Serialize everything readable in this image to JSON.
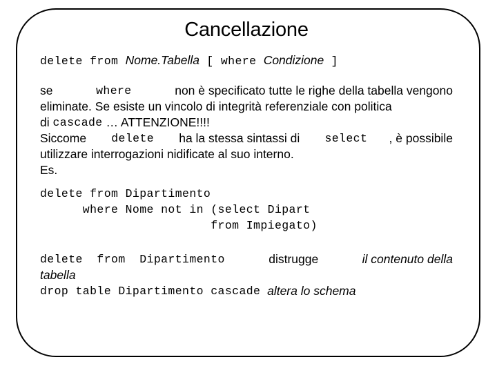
{
  "slide": {
    "title": "Cancellazione",
    "syntax": {
      "kw_delete_from": "delete from ",
      "table_placeholder": "Nome.Tabella",
      "bracket_open": " [ where ",
      "condition_placeholder": "Condizione",
      "bracket_close": " ]"
    },
    "paragraph1": {
      "line1_a": "se ",
      "line1_kw": "where",
      "line1_b": " non è specificato tutte le righe della tabella vengono",
      "line2": "eliminate. Se esiste un vincolo di integrità referenziale con politica",
      "line3_a": "di ",
      "line3_kw": "cascade",
      "line3_b": " … ATTENZIONE!!!!"
    },
    "paragraph2": {
      "line1_a": "Siccome ",
      "line1_kw1": "delete",
      "line1_b": " ha la stessa sintassi di ",
      "line1_kw2": "select",
      "line1_c": ", è possibile",
      "line2": "utilizzare interrogazioni nidificate al suo interno.",
      "line3": "Es."
    },
    "code_example": {
      "line1": "delete from Dipartimento",
      "line2": "      where Nome not in (select Dipart",
      "line3": "                        from Impiegato)"
    },
    "closing": {
      "line1_kw": "delete  from  Dipartimento",
      "line1_text": "distrugge",
      "line1_ital": "il contenuto della",
      "line2_ital": "tabella",
      "line3_kw": "drop table Dipartimento cascade",
      "line3_ital": "altera lo schema"
    },
    "colors": {
      "text": "#000000",
      "background": "#ffffff",
      "border": "#000000"
    }
  }
}
